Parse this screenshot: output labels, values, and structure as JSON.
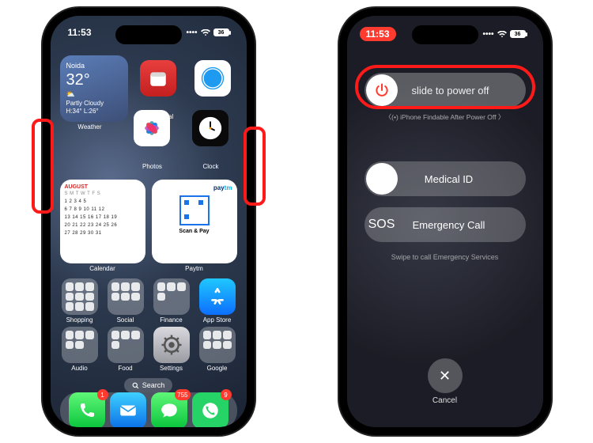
{
  "left": {
    "status": {
      "time": "11:53",
      "battery": "36"
    },
    "weather": {
      "city": "Noida",
      "temp": "32°",
      "cond": "Partly Cloudy",
      "range": "H:34° L:26°",
      "label": "Weather"
    },
    "top_apps": [
      {
        "name": "Fantastical"
      },
      {
        "name": "Safari"
      },
      {
        "name": "Photos"
      },
      {
        "name": "Clock"
      }
    ],
    "calendar": {
      "month": "AUGUST",
      "header": "S M T W T F S",
      "rows": [
        "        1  2  3  4  5",
        " 6  7  8  9 10 11 12",
        "13 14 15 16 17 18 19",
        "20 21 22 23 24 25 26",
        "27 28 29 30 31"
      ],
      "label": "Calendar"
    },
    "paytm": {
      "brand1": "pay",
      "brand2": "tm",
      "action": "Scan & Pay",
      "label": "Paytm"
    },
    "grid": [
      {
        "label": "Shopping"
      },
      {
        "label": "Social"
      },
      {
        "label": "Finance"
      },
      {
        "label": "App Store"
      },
      {
        "label": "Audio"
      },
      {
        "label": "Food"
      },
      {
        "label": "Settings"
      },
      {
        "label": "Google"
      }
    ],
    "search": "Search",
    "dock": {
      "phone_badge": "1",
      "messages_badge": "755",
      "whatsapp_badge": "9"
    }
  },
  "right": {
    "status": {
      "time": "11:53",
      "battery": "36"
    },
    "power_slider": "slide to power off",
    "findable": "iPhone Findable After Power Off",
    "medical": "Medical ID",
    "sos": "SOS",
    "emergency": "Emergency Call",
    "swipe_hint": "Swipe to call Emergency Services",
    "cancel": "Cancel"
  }
}
